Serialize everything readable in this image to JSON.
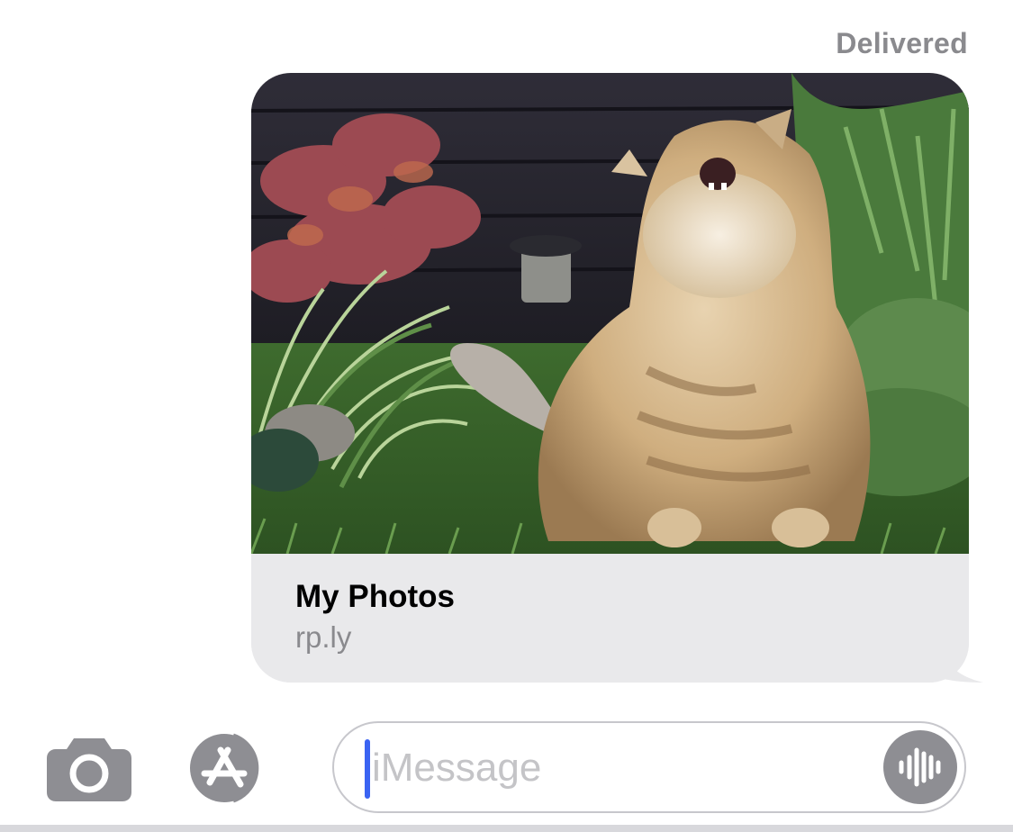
{
  "conversation": {
    "status": "Delivered",
    "message": {
      "link_preview": {
        "image_subject": "fluffy long-haired cat in a garden, head tilted up",
        "title": "My Photos",
        "url": "rp.ly"
      }
    }
  },
  "compose": {
    "camera_icon": "camera-icon",
    "appstore_icon": "app-store-icon",
    "placeholder": "iMessage",
    "audio_icon": "audio-waveform-icon"
  },
  "colors": {
    "bubble_gray": "#e9e9eb",
    "secondary_text": "#8a8a8e",
    "icon_gray": "#8e8e93",
    "cursor_blue": "#3a63f2"
  }
}
